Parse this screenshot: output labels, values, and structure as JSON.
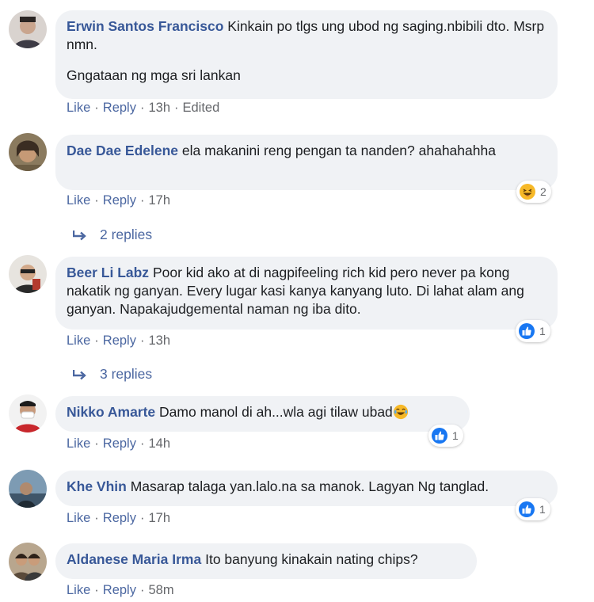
{
  "comments": [
    {
      "author": "Erwin Santos Francisco",
      "text": "Kinkain po tlgs ung ubod ng saging.nbibili dto. Msrp nmn.",
      "text2": "Gngataan ng mga sri lankan",
      "like": "Like",
      "reply": "Reply",
      "time": "13h",
      "edited": "Edited"
    },
    {
      "author": "Dae Dae Edelene",
      "text": "ela makanini reng pengan ta nanden? ahahahahha",
      "like": "Like",
      "reply": "Reply",
      "time": "17h",
      "reaction_icon": "haha-emoji-icon",
      "reaction_count": "2",
      "replies_label": "2 replies"
    },
    {
      "author": "Beer Li Labz",
      "text": "Poor kid ako at di nagpifeeling rich kid pero never pa kong nakatik ng ganyan. Every lugar kasi kanya kanyang luto. Di lahat alam ang ganyan. Napakajudgemental naman ng iba dito.",
      "like": "Like",
      "reply": "Reply",
      "time": "13h",
      "reaction_icon": "like-thumb-icon",
      "reaction_count": "1",
      "replies_label": "3 replies"
    },
    {
      "author": "Nikko Amarte",
      "text": "Damo manol di ah...wla agi tilaw ubad",
      "like": "Like",
      "reply": "Reply",
      "time": "14h",
      "reaction_icon": "like-thumb-icon",
      "reaction_count": "1"
    },
    {
      "author": "Khe Vhin",
      "text": "Masarap talaga yan.lalo.na sa manok. Lagyan Ng tanglad.",
      "like": "Like",
      "reply": "Reply",
      "time": "17h",
      "reaction_icon": "like-thumb-icon",
      "reaction_count": "1"
    },
    {
      "author": "Aldanese Maria Irma",
      "text": "Ito banyung kinakain nating chips?",
      "like": "Like",
      "reply": "Reply",
      "time": "58m"
    }
  ],
  "colors": {
    "author": "#385898",
    "bubble": "#f0f2f5",
    "link": "#4b67a1",
    "like_blue": "#1877f2",
    "haha_yellow": "#f7b928"
  }
}
